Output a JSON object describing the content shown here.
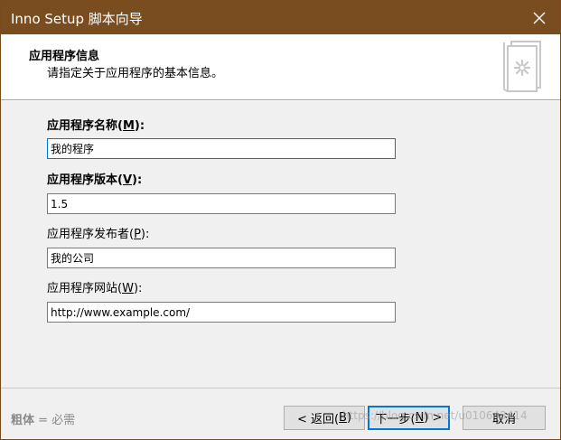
{
  "window": {
    "title": "Inno Setup 脚本向导"
  },
  "header": {
    "title": "应用程序信息",
    "subtitle": "请指定关于应用程序的基本信息。"
  },
  "fields": {
    "app_name": {
      "label": "应用程序名称(",
      "mnemonic": "M",
      "suffix": "):",
      "value": "我的程序"
    },
    "app_version": {
      "label": "应用程序版本(",
      "mnemonic": "V",
      "suffix": "):",
      "value": "1.5"
    },
    "app_publisher": {
      "label": "应用程序发布者(",
      "mnemonic": "P",
      "suffix": "):",
      "value": "我的公司"
    },
    "app_website": {
      "label": "应用程序网站(",
      "mnemonic": "W",
      "suffix": "):",
      "value": "http://www.example.com/"
    }
  },
  "footer": {
    "legend_bold": "粗体",
    "legend_rest": " = 必需",
    "back": {
      "label": "< 返回(",
      "mnemonic": "B",
      "suffix": ")"
    },
    "next": {
      "label": "下一步(",
      "mnemonic": "N",
      "suffix": ") >"
    },
    "cancel": {
      "label": "取消"
    }
  },
  "watermark": "https://blog.csdn.net/u010643414",
  "colors": {
    "titlebar": "#7a4d21",
    "focus": "#0078d7",
    "panel": "#f0f0f0"
  },
  "icons": {
    "close": "close-icon",
    "wizard": "wizard-page-icon"
  }
}
